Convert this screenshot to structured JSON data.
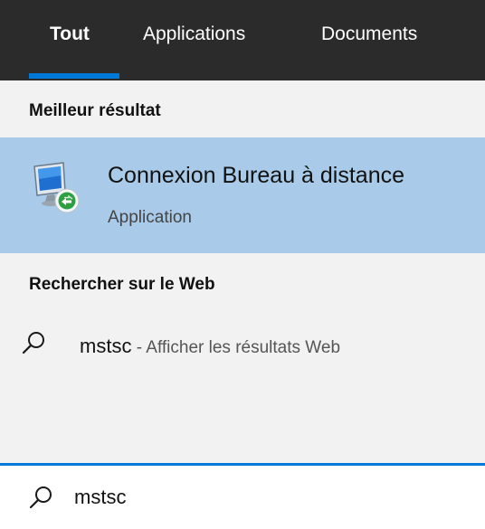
{
  "tabs": [
    {
      "label": "Tout",
      "active": true
    },
    {
      "label": "Applications",
      "active": false
    },
    {
      "label": "Documents",
      "active": false
    }
  ],
  "sections": {
    "best": {
      "title": "Meilleur résultat",
      "item": {
        "name": "Connexion Bureau à distance",
        "type": "Application",
        "icon": "remote-desktop-icon"
      }
    },
    "web": {
      "title": "Rechercher sur le Web",
      "item": {
        "query": "mstsc",
        "separator": " - ",
        "hint": "Afficher les résultats Web",
        "icon": "search-icon"
      }
    }
  },
  "search": {
    "value": "mstsc",
    "icon": "search-icon"
  },
  "colors": {
    "tabbar_bg": "#2b2b2b",
    "accent": "#0078d7",
    "selected_row": "#a9cbe9",
    "panel_bg": "#f2f2f2"
  }
}
